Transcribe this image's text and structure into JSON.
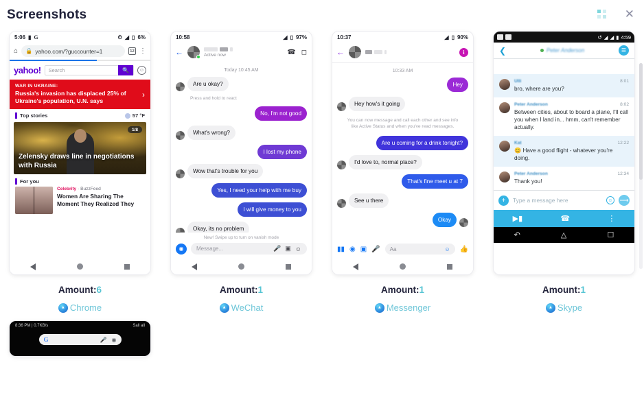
{
  "header": {
    "title": "Screenshots",
    "grid_icon": "grid-dots-icon",
    "close_icon": "close-icon",
    "accent": "#7fd7dd"
  },
  "cards": [
    {
      "amount_label": "Amount:",
      "amount_value": "6",
      "app": "Chrome",
      "app_icon": "app-circle-icon",
      "statusbar": {
        "time": "5:06",
        "battery": "6%",
        "icons": [
          "image-icon",
          "google-icon",
          "vibrate-icon",
          "wifi-icon",
          "battery-icon"
        ]
      },
      "browser": {
        "home_icon": "home-icon",
        "lock_icon": "lock-icon",
        "url": "yahoo.com/?guccounter=1",
        "tab_count": "12",
        "menu_icon": "overflow-menu-icon"
      },
      "yahoo": {
        "logo": "yahoo!",
        "search_placeholder": "Search",
        "search_icon": "search-icon",
        "avatar_icon": "account-icon",
        "banner_kicker": "WAR IN UKRAINE:",
        "banner_headline": "Russia's invasion has displaced 25% of Ukraine's population, U.N. says",
        "chevron": "›",
        "top_stories_label": "Top stories",
        "weather": "57 °F",
        "hero_badge": "1/8",
        "hero_headline": "Zelensky draws line in negotiations with Russia",
        "for_you_label": "For you",
        "story_category": "Celebrity",
        "story_source": "BuzzFeed",
        "story_title": "Women Are Sharing The Moment They Realized They"
      },
      "nav": [
        "back-triangle-icon",
        "home-circle-icon",
        "recents-square-icon"
      ]
    },
    {
      "amount_label": "Amount:",
      "amount_value": "1",
      "app": "WeChat",
      "app_icon": "app-circle-icon",
      "statusbar": {
        "time": "10:58",
        "battery": "97%",
        "icons": [
          "wifi-icon",
          "battery-icon"
        ]
      },
      "chat": {
        "back_icon": "back-arrow-icon",
        "presence": "Active now",
        "call_icon": "phone-icon",
        "video_icon": "video-camera-icon",
        "daystamp": "Today 10:45 AM",
        "react_hint": "Press and hold to react",
        "messages": [
          {
            "from": "in",
            "text": "Are u okay?"
          },
          {
            "from": "out",
            "text": "No, I'm not good",
            "color": "#9b22cf"
          },
          {
            "from": "in",
            "text": "What's wrong?"
          },
          {
            "from": "out",
            "text": "I lost my phone",
            "color": "#6f3ad4"
          },
          {
            "from": "in",
            "text": "Wow that's trouble for you"
          },
          {
            "from": "out",
            "text": "Yes, I need your help with me buy",
            "color": "#3d4fd4"
          },
          {
            "from": "out",
            "text": "I will give money to you",
            "color": "#3d4fd4"
          },
          {
            "from": "in",
            "text": "Okay, its no problem"
          }
        ],
        "vanish_hint": "New! Swipe up to turn on vanish mode",
        "composer_placeholder": "Message...",
        "composer_icons": [
          "camera-icon",
          "microphone-icon",
          "gallery-icon",
          "sticker-icon"
        ]
      },
      "nav": [
        "back-triangle-icon",
        "home-circle-icon",
        "recents-square-icon"
      ]
    },
    {
      "amount_label": "Amount:",
      "amount_value": "1",
      "app": "Messenger",
      "app_icon": "app-circle-icon",
      "statusbar": {
        "time": "10:37",
        "battery": "90%",
        "icons": [
          "wifi-icon",
          "battery-icon"
        ]
      },
      "chat": {
        "back_icon": "back-arrow-icon",
        "info_icon": "info-icon",
        "daystamp": "10:33 AM",
        "notice": "You can now message and call each other and see info like Active Status and when you've read messages.",
        "messages": [
          {
            "from": "out",
            "text": "Hey",
            "color": "#9b2ad6"
          },
          {
            "from": "in",
            "text": "Hey how's it going"
          },
          {
            "from": "out",
            "text": "Are u coming for a drink tonight?",
            "color": "#4034db"
          },
          {
            "from": "in",
            "text": "I'd love to, normal place?"
          },
          {
            "from": "out",
            "text": "That's fine meet u at 7",
            "color": "#2f5bea"
          },
          {
            "from": "in",
            "text": "See u there"
          },
          {
            "from": "out",
            "text": "Okay",
            "color": "#1d8bf5"
          }
        ],
        "composer_placeholder": "Aa",
        "composer_icons": [
          "apps-grid-icon",
          "camera-icon",
          "gallery-icon",
          "microphone-icon",
          "emoji-icon",
          "thumbs-up-icon"
        ]
      },
      "nav": [
        "back-triangle-icon",
        "home-circle-icon",
        "recents-square-icon"
      ]
    },
    {
      "amount_label": "Amount:",
      "amount_value": "1",
      "app": "Skype",
      "app_icon": "app-circle-icon",
      "statusbar": {
        "time": "4:59",
        "icons": [
          "mail-icon",
          "download-icon",
          "sync-icon",
          "wifi-icon",
          "signal-icon",
          "battery-icon"
        ]
      },
      "chat": {
        "back_icon": "back-chevron-icon",
        "contact_name": "Peter Anderson",
        "menu_icon": "chat-menu-icon",
        "messages": [
          {
            "sender": "Ulli",
            "time": "8:01",
            "text": "bro, where are you?",
            "highlight": true
          },
          {
            "sender": "Peter Anderson",
            "time": "8:02",
            "text": "Between cities, about to board a plane, I'll call you when I land in... hmm, can't remember actually.",
            "highlight": false
          },
          {
            "sender": "Kat",
            "time": "12:22",
            "text": "😊 Have a good flight - whatever you're doing.",
            "highlight": true
          },
          {
            "sender": "Peter Anderson",
            "time": "12:34",
            "text": "Thank you!",
            "highlight": false
          }
        ],
        "composer_placeholder": "Type a message here",
        "composer_icons": [
          "plus-icon",
          "emoji-icon",
          "send-icon"
        ],
        "callbar_icons": [
          "video-call-icon",
          "voice-call-icon",
          "overflow-menu-icon"
        ]
      },
      "nav": [
        "back-arrow-icon",
        "home-icon",
        "recents-icon"
      ]
    },
    {
      "partial": true,
      "home": {
        "status_left": "8:36 PM | 0.7KB/s",
        "status_right": "Sall all",
        "google_logo": "G",
        "search_icons": [
          "microphone-icon",
          "lens-icon"
        ]
      }
    }
  ]
}
